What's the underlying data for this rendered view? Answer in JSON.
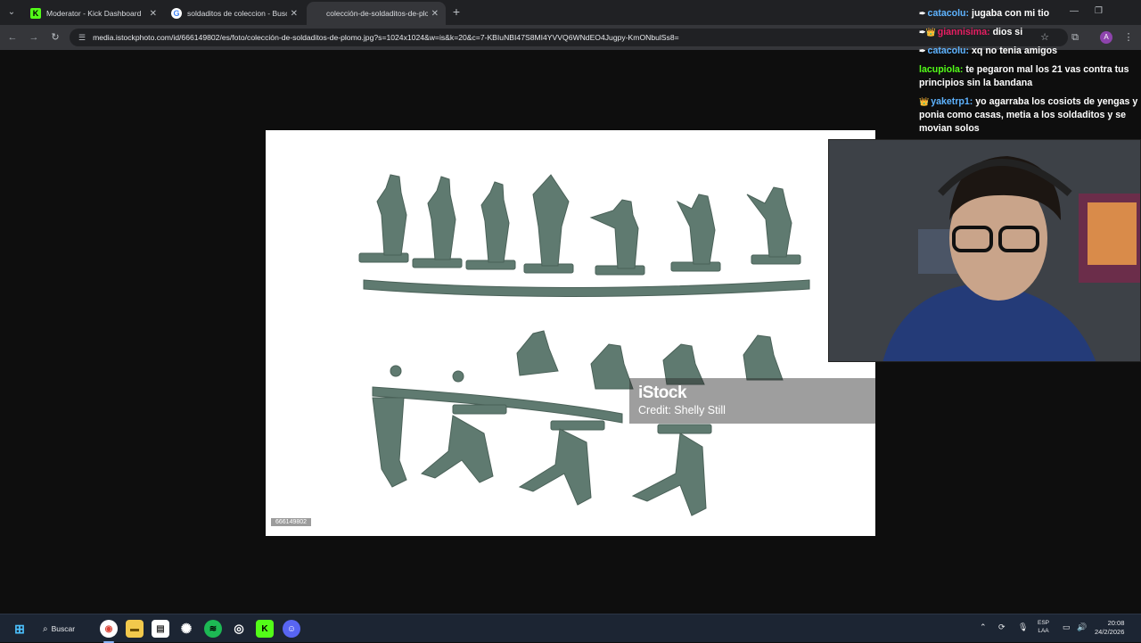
{
  "browser": {
    "tabs": [
      {
        "label": "Moderator - Kick Dashboard",
        "favicon_color": "#53fc18",
        "active": false
      },
      {
        "label": "soldaditos de coleccion - Busca",
        "favicon_color": "#4285f4",
        "active": false
      },
      {
        "label": "colección-de-soldaditos-de-plo",
        "favicon_color": "#35363a",
        "active": true
      }
    ],
    "new_tab_icon": "plus-icon",
    "window_controls": {
      "minimize": "—",
      "restore": "❐",
      "close": "✕"
    },
    "url": "media.istockphoto.com/id/666149802/es/foto/colección-de-soldaditos-de-plomo.jpg?s=1024x1024&w=is&k=20&c=7-KBIuNBI47S8MI4YVVQ6WNdEO4Jugpy-KmONbulSs8=",
    "profile_initial": "A"
  },
  "image": {
    "watermark_brand": "iStock",
    "watermark_credit": "Credit: Shelly Still",
    "image_id": "666149802",
    "soldier_color": "#5f7a70"
  },
  "chat": {
    "messages": [
      {
        "prefix": "✒",
        "user": "catacolu:",
        "user_color": "#5eb3ff",
        "text": "jugaba con mi tio"
      },
      {
        "prefix": "✒👑",
        "user": "giannisima:",
        "user_color": "#e91e63",
        "text": "dios si"
      },
      {
        "prefix": "✒",
        "user": "catacolu:",
        "user_color": "#5eb3ff",
        "text": "xq no tenia amigos"
      },
      {
        "prefix": "",
        "user": "lacupiola:",
        "user_color": "#53fc18",
        "text": "te pegaron mal los 21 vas contra tus principios sin la bandana"
      },
      {
        "prefix": "👑",
        "user": "yaketrp1:",
        "user_color": "#5eb3ff",
        "text": "yo agarraba los cosiots de yengas y ponia como casas, metia a los soldaditos y se movian solos"
      }
    ]
  },
  "taskbar": {
    "search_label": "Buscar",
    "apps": [
      "windows-start",
      "chrome",
      "file-explorer",
      "notepad",
      "chatgpt",
      "spotify",
      "obs",
      "kick",
      "discord"
    ],
    "language": "ESP",
    "language_sub": "LAA",
    "time": "20:08",
    "date": "24/2/2026"
  }
}
